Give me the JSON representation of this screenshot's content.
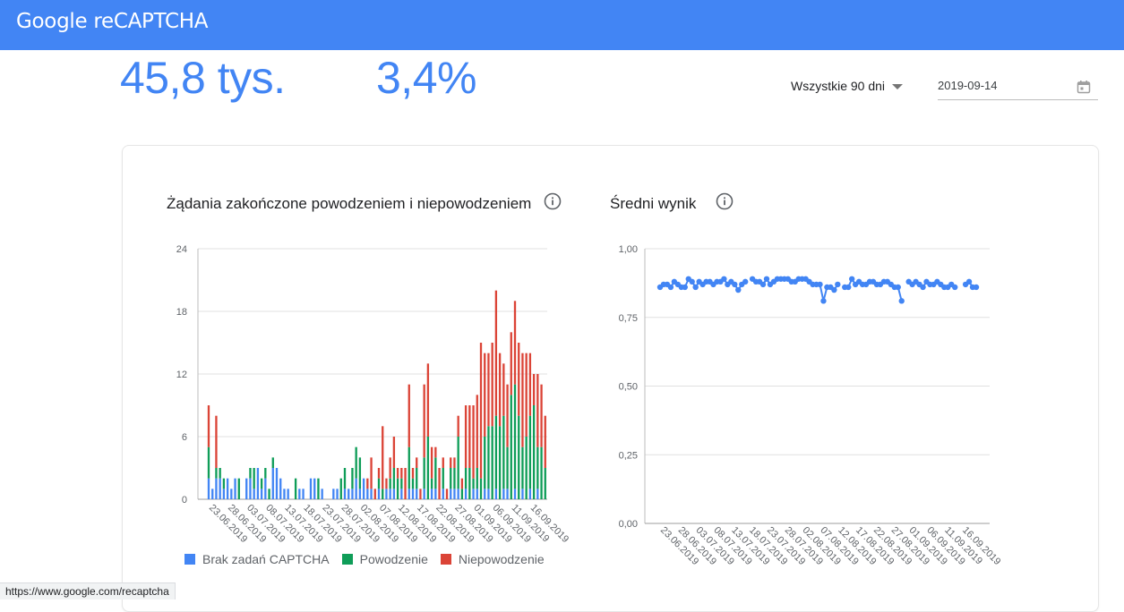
{
  "header": {
    "brand_google": "Google",
    "brand_product": "reCAPTCHA"
  },
  "stats": {
    "requests": "45,8 tys.",
    "rate": "3,4%"
  },
  "controls": {
    "range_label": "Wszystkie 90 dni",
    "date_value": "2019-09-14"
  },
  "status_url": "https://www.google.com/recaptcha",
  "colors": {
    "accent": "#4285f4",
    "no_challenge": "#4285f4",
    "passed": "#0f9d58",
    "failed": "#db4437"
  },
  "icons": {
    "info": "info-icon",
    "calendar": "calendar-icon",
    "dropdown": "chevron-down-icon"
  },
  "chart_data": [
    {
      "type": "bar",
      "stacked": true,
      "title": "Żądania zakończone powodzeniem i niepowodzeniem",
      "ylim": [
        0,
        24
      ],
      "yticks": [
        "0",
        "6",
        "12",
        "18",
        "24"
      ],
      "xtick_labels": [
        "23.06.2019",
        "28.06.2019",
        "03.07.2019",
        "08.07.2019",
        "13.07.2019",
        "18.07.2019",
        "23.07.2019",
        "28.07.2019",
        "02.08.2019",
        "07.08.2019",
        "12.08.2019",
        "17.08.2019",
        "22.08.2019",
        "27.08.2019",
        "01.09.2019",
        "06.09.2019",
        "11.09.2019",
        "16.09.2019"
      ],
      "legend": [
        "Brak zadań CAPTCHA",
        "Powodzenie",
        "Niepowodzenie"
      ],
      "legend_position": "bottom",
      "grid": true,
      "series": [
        {
          "name": "Brak zadań CAPTCHA",
          "values": [
            2,
            1,
            2,
            2,
            1,
            2,
            1,
            2,
            0,
            0,
            2,
            2,
            1,
            3,
            1,
            2,
            0,
            3,
            3,
            2,
            1,
            1,
            0,
            0,
            1,
            1,
            0,
            2,
            2,
            0,
            1,
            0,
            0,
            1,
            1,
            0,
            1,
            1,
            1,
            2,
            1,
            2,
            1,
            1,
            0,
            1,
            0,
            1,
            1,
            1,
            0,
            1,
            0,
            1,
            1,
            1,
            0,
            1,
            0,
            1,
            1,
            0,
            1,
            0,
            1,
            1,
            1,
            0,
            1,
            0,
            1,
            1,
            0,
            1,
            1,
            0,
            1,
            0,
            1,
            1,
            0,
            1,
            0,
            1,
            0,
            1,
            0,
            1,
            0,
            0
          ]
        },
        {
          "name": "Powodzenie",
          "values": [
            3,
            0,
            1,
            1,
            1,
            0,
            0,
            0,
            2,
            0,
            0,
            1,
            2,
            0,
            1,
            1,
            1,
            1,
            0,
            0,
            0,
            0,
            0,
            2,
            0,
            0,
            0,
            0,
            0,
            2,
            0,
            0,
            0,
            0,
            0,
            2,
            2,
            0,
            2,
            3,
            3,
            0,
            0,
            0,
            0,
            1,
            1,
            0,
            1,
            2,
            2,
            1,
            0,
            4,
            1,
            2,
            0,
            3,
            6,
            1,
            3,
            0,
            2,
            0,
            2,
            2,
            5,
            1,
            2,
            3,
            1,
            2,
            2,
            5,
            6,
            7,
            7,
            7,
            7,
            4,
            10,
            10,
            8,
            4,
            6,
            7,
            9,
            4,
            5,
            3
          ]
        },
        {
          "name": "Niepowodzenie",
          "values": [
            4,
            0,
            5,
            0,
            0,
            0,
            0,
            0,
            0,
            0,
            0,
            0,
            0,
            0,
            0,
            0,
            0,
            0,
            0,
            0,
            0,
            0,
            0,
            0,
            0,
            0,
            0,
            0,
            0,
            0,
            0,
            0,
            0,
            0,
            0,
            0,
            0,
            0,
            0,
            0,
            0,
            0,
            1,
            3,
            1,
            1,
            6,
            1,
            2,
            3,
            1,
            1,
            3,
            6,
            1,
            1,
            1,
            7,
            7,
            3,
            1,
            3,
            1,
            1,
            1,
            1,
            2,
            1,
            6,
            6,
            7,
            7,
            13,
            8,
            7,
            8,
            12,
            7,
            5,
            6,
            6,
            8,
            7,
            9,
            8,
            6,
            3,
            7,
            6,
            5
          ]
        }
      ]
    },
    {
      "type": "scatter",
      "title": "Średni wynik",
      "ylim": [
        0,
        1
      ],
      "yticks": [
        "0,00",
        "0,25",
        "0,50",
        "0,75",
        "1,00"
      ],
      "xtick_labels": [
        "23.06.2019",
        "28.06.2019",
        "03.07.2019",
        "08.07.2019",
        "13.07.2019",
        "18.07.2019",
        "23.07.2019",
        "28.07.2019",
        "02.08.2019",
        "07.08.2019",
        "12.08.2019",
        "17.08.2019",
        "22.08.2019",
        "27.08.2019",
        "01.09.2019",
        "06.09.2019",
        "11.09.2019",
        "16.09.2019"
      ],
      "grid": true,
      "values": [
        0.86,
        0.87,
        0.87,
        0.86,
        0.88,
        0.87,
        0.86,
        0.86,
        0.89,
        0.88,
        0.86,
        0.88,
        0.87,
        0.88,
        0.88,
        0.87,
        0.88,
        0.88,
        0.89,
        0.87,
        0.88,
        0.87,
        0.85,
        0.87,
        0.88,
        null,
        0.89,
        0.88,
        0.88,
        0.87,
        0.89,
        0.87,
        0.88,
        0.89,
        0.89,
        0.89,
        0.89,
        0.88,
        0.88,
        0.89,
        0.89,
        0.89,
        0.88,
        0.87,
        0.87,
        0.87,
        0.81,
        0.86,
        0.86,
        0.85,
        0.87,
        null,
        0.86,
        0.86,
        0.89,
        0.87,
        0.88,
        0.87,
        0.87,
        0.88,
        0.88,
        0.87,
        0.87,
        0.88,
        0.88,
        0.87,
        0.86,
        0.86,
        0.81,
        null,
        0.88,
        0.87,
        0.88,
        0.87,
        0.86,
        0.88,
        0.87,
        0.87,
        0.88,
        0.87,
        0.86,
        0.86,
        0.87,
        0.86,
        null,
        null,
        0.87,
        0.88,
        0.86,
        0.86
      ]
    }
  ]
}
